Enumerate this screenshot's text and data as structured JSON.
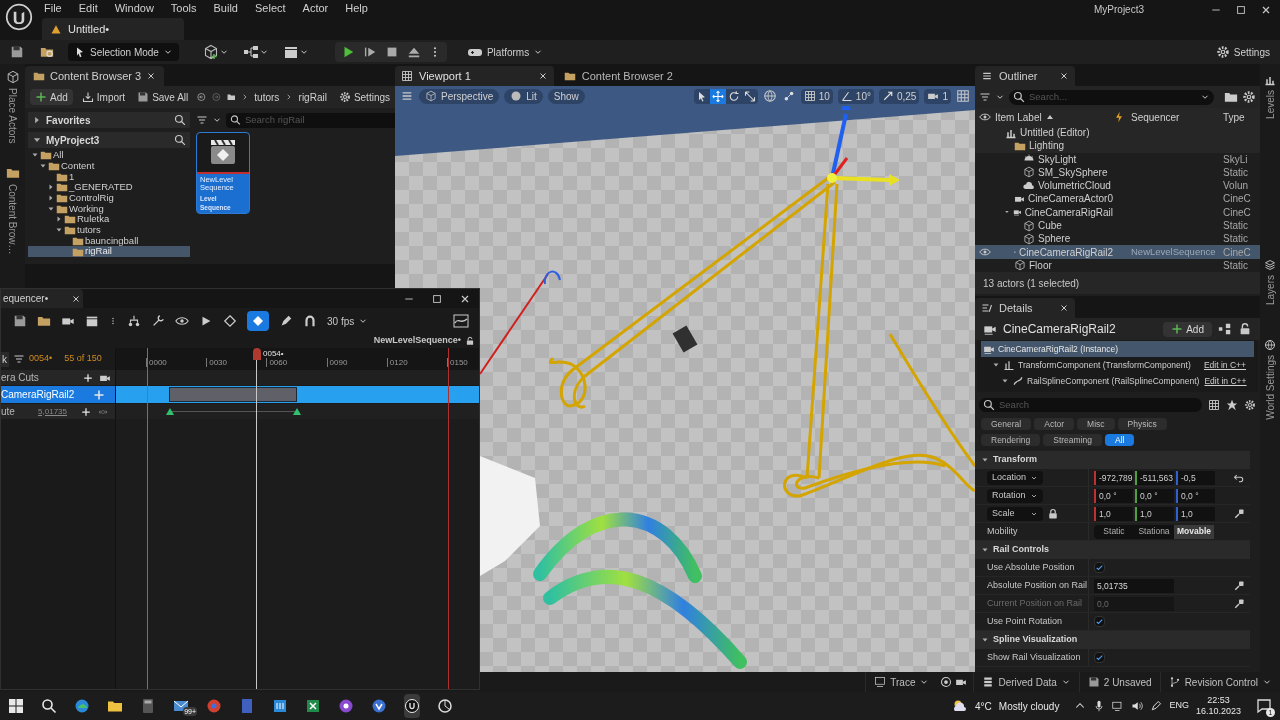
{
  "menu": [
    "File",
    "Edit",
    "Window",
    "Tools",
    "Build",
    "Select",
    "Actor",
    "Help"
  ],
  "project_name": "MyProject3",
  "level_tab": {
    "label": "Untitled•"
  },
  "toolbar": {
    "mode": "Selection Mode",
    "platforms": "Platforms",
    "settings": "Settings"
  },
  "side_left": [
    "Place Actors",
    "Content Brow…"
  ],
  "side_right": [
    "Levels",
    "Layers",
    "World Settings"
  ],
  "content_browser": {
    "tab": "Content Browser 3",
    "actions": [
      "Add",
      "Import",
      "Save All"
    ],
    "path": [
      "tutors",
      "rigRail"
    ],
    "settings": "Settings",
    "sections": [
      {
        "label": "Favorites",
        "expanded": false
      },
      {
        "label": "MyProject3",
        "expanded": true
      }
    ],
    "tree": [
      {
        "label": "All",
        "expanded": true,
        "selected": false,
        "children": [
          {
            "label": "Content",
            "expanded": true,
            "selected": false,
            "children": [
              {
                "label": "1",
                "selected": false
              },
              {
                "label": "_GENERATED",
                "expanded": false,
                "selected": false
              },
              {
                "label": "ControlRig",
                "expanded": false,
                "selected": false
              },
              {
                "label": "Working",
                "expanded": true,
                "selected": false,
                "children": [
                  {
                    "label": "Ruletka",
                    "expanded": false,
                    "selected": false
                  },
                  {
                    "label": "tutors",
                    "expanded": true,
                    "selected": false,
                    "children": [
                      {
                        "label": "bauncingball",
                        "selected": false
                      },
                      {
                        "label": "rigRail",
                        "selected": true
                      }
                    ]
                  }
                ]
              }
            ]
          }
        ]
      }
    ],
    "search": {
      "placeholder": "Search rigRail"
    },
    "assets": [
      {
        "name": "NewLevel Sequence",
        "type": "Level Sequence",
        "selected": true
      }
    ]
  },
  "viewport": {
    "tabs": [
      {
        "label": "Viewport 1",
        "selected": true
      },
      {
        "label": "Content Browser 2",
        "selected": false
      }
    ],
    "view": "Perspective",
    "lighting": "Lit",
    "show": "Show",
    "grid_snap": "10",
    "rotation_snap": "10°",
    "scale_snap": "0,25",
    "camera_speed": "1"
  },
  "sequencer": {
    "title": "equencer•",
    "fps": "30 fps",
    "sequence": "NewLevelSequence•",
    "search_label": "k",
    "current_frame": "0054•",
    "frame_count": "55 of 150",
    "playhead": "0054•",
    "ticks": [
      "0000",
      "0030",
      "0060",
      "0090",
      "0120",
      "0150"
    ],
    "tracks": [
      {
        "kind": "folder",
        "label": "era Cuts",
        "selected": false
      },
      {
        "kind": "actor",
        "label": "CameraRigRail2",
        "selected": true
      },
      {
        "kind": "property",
        "label": "ute",
        "value": "5,01735",
        "selected": false
      }
    ]
  },
  "outliner": {
    "tab": "Outliner",
    "search": {
      "placeholder": "Search..."
    },
    "columns": [
      "Item Label",
      "Sequencer",
      "Type"
    ],
    "items": [
      {
        "label": "Untitled (Editor)",
        "kind": "level",
        "selected": false,
        "children": [
          {
            "label": "Lighting",
            "kind": "folder",
            "selected": false,
            "children": [
              {
                "label": "SkyLight",
                "kind": "light",
                "type": "SkyLi",
                "selected": false
              },
              {
                "label": "SM_SkySphere",
                "kind": "mesh",
                "type": "Static",
                "selected": false
              },
              {
                "label": "VolumetricCloud",
                "kind": "cloud",
                "type": "Volun",
                "selected": false
              }
            ]
          },
          {
            "label": "CineCameraActor0",
            "kind": "camera",
            "type": "CineC",
            "selected": false
          },
          {
            "label": "CineCameraRigRail",
            "kind": "rig",
            "type": "CineC",
            "expanded": true,
            "selected": false,
            "children": [
              {
                "label": "Cube",
                "kind": "mesh",
                "type": "Static",
                "selected": false
              },
              {
                "label": "Sphere",
                "kind": "mesh",
                "type": "Static",
                "selected": false
              }
            ]
          },
          {
            "label": "CineCameraRigRail2",
            "kind": "rig",
            "sequencer": "NewLevelSequence",
            "type": "CineC",
            "selected": true
          },
          {
            "label": "Floor",
            "kind": "mesh",
            "type": "Static",
            "selected": false
          }
        ]
      }
    ],
    "footer": "13 actors (1 selected)"
  },
  "details": {
    "tab": "Details",
    "title": "CineCameraRigRail2",
    "add": "Add",
    "components": [
      {
        "label": "CineCameraRigRail2 (Instance)",
        "selected": true,
        "children": [
          {
            "label": "TransformComponent (TransformComponent)",
            "link": "Edit in C++",
            "expanded": true,
            "selected": false,
            "children": [
              {
                "label": "RailSplineComponent (RailSplineComponent)",
                "link": "Edit in C++",
                "expanded": true,
                "selected": false
              }
            ]
          }
        ]
      }
    ],
    "search": {
      "placeholder": "Search"
    },
    "filters": [
      {
        "label": "General",
        "selected": false
      },
      {
        "label": "Actor",
        "selected": false
      },
      {
        "label": "Misc",
        "selected": false
      },
      {
        "label": "Physics",
        "selected": false
      },
      {
        "label": "Rendering",
        "selected": false
      },
      {
        "label": "Streaming",
        "selected": false
      },
      {
        "label": "All",
        "selected": true
      }
    ],
    "sections": [
      {
        "title": "Transform",
        "expanded": true,
        "rows": [
          {
            "kind": "vector",
            "label": "Location",
            "values": [
              "-972,789",
              "-511,563",
              "-0,5"
            ],
            "reset": true
          },
          {
            "kind": "vector",
            "label": "Rotation",
            "values": [
              "0,0 °",
              "0,0 °",
              "0,0 °"
            ]
          },
          {
            "kind": "vector",
            "label": "Scale",
            "values": [
              "1,0",
              "1,0",
              "1,0"
            ],
            "locked": true,
            "keyable": true
          },
          {
            "kind": "segmented",
            "label": "Mobility",
            "options": [
              {
                "label": "Static",
                "selected": false
              },
              {
                "label": "Stationa",
                "selected": false
              },
              {
                "label": "Movable",
                "selected": true
              }
            ]
          }
        ]
      },
      {
        "title": "Rail Controls",
        "expanded": true,
        "rows": [
          {
            "kind": "checkbox",
            "label": "Use Absolute Position",
            "checked": true
          },
          {
            "kind": "number",
            "label": "Absolute Position on Rail",
            "value": "5,01735",
            "disabled": false,
            "keyable": true
          },
          {
            "kind": "number",
            "label": "Current Position on Rail",
            "value": "0,0",
            "disabled": true,
            "keyable": true
          },
          {
            "kind": "checkbox",
            "label": "Use Point Rotation",
            "checked": true
          }
        ]
      },
      {
        "title": "Spline Visualization",
        "expanded": true,
        "rows": [
          {
            "kind": "checkbox",
            "label": "Show Rail Visualization",
            "checked": true
          }
        ]
      }
    ]
  },
  "status_bar": [
    "Trace",
    "Derived Data",
    "2 Unsaved",
    "Revision Control"
  ],
  "taskbar": {
    "mail_badge": "99+",
    "temperature": "4°C",
    "weather": "Mostly cloudy",
    "language": "ENG",
    "time": "22:53",
    "date": "16.10.2023",
    "notifications": "1"
  }
}
